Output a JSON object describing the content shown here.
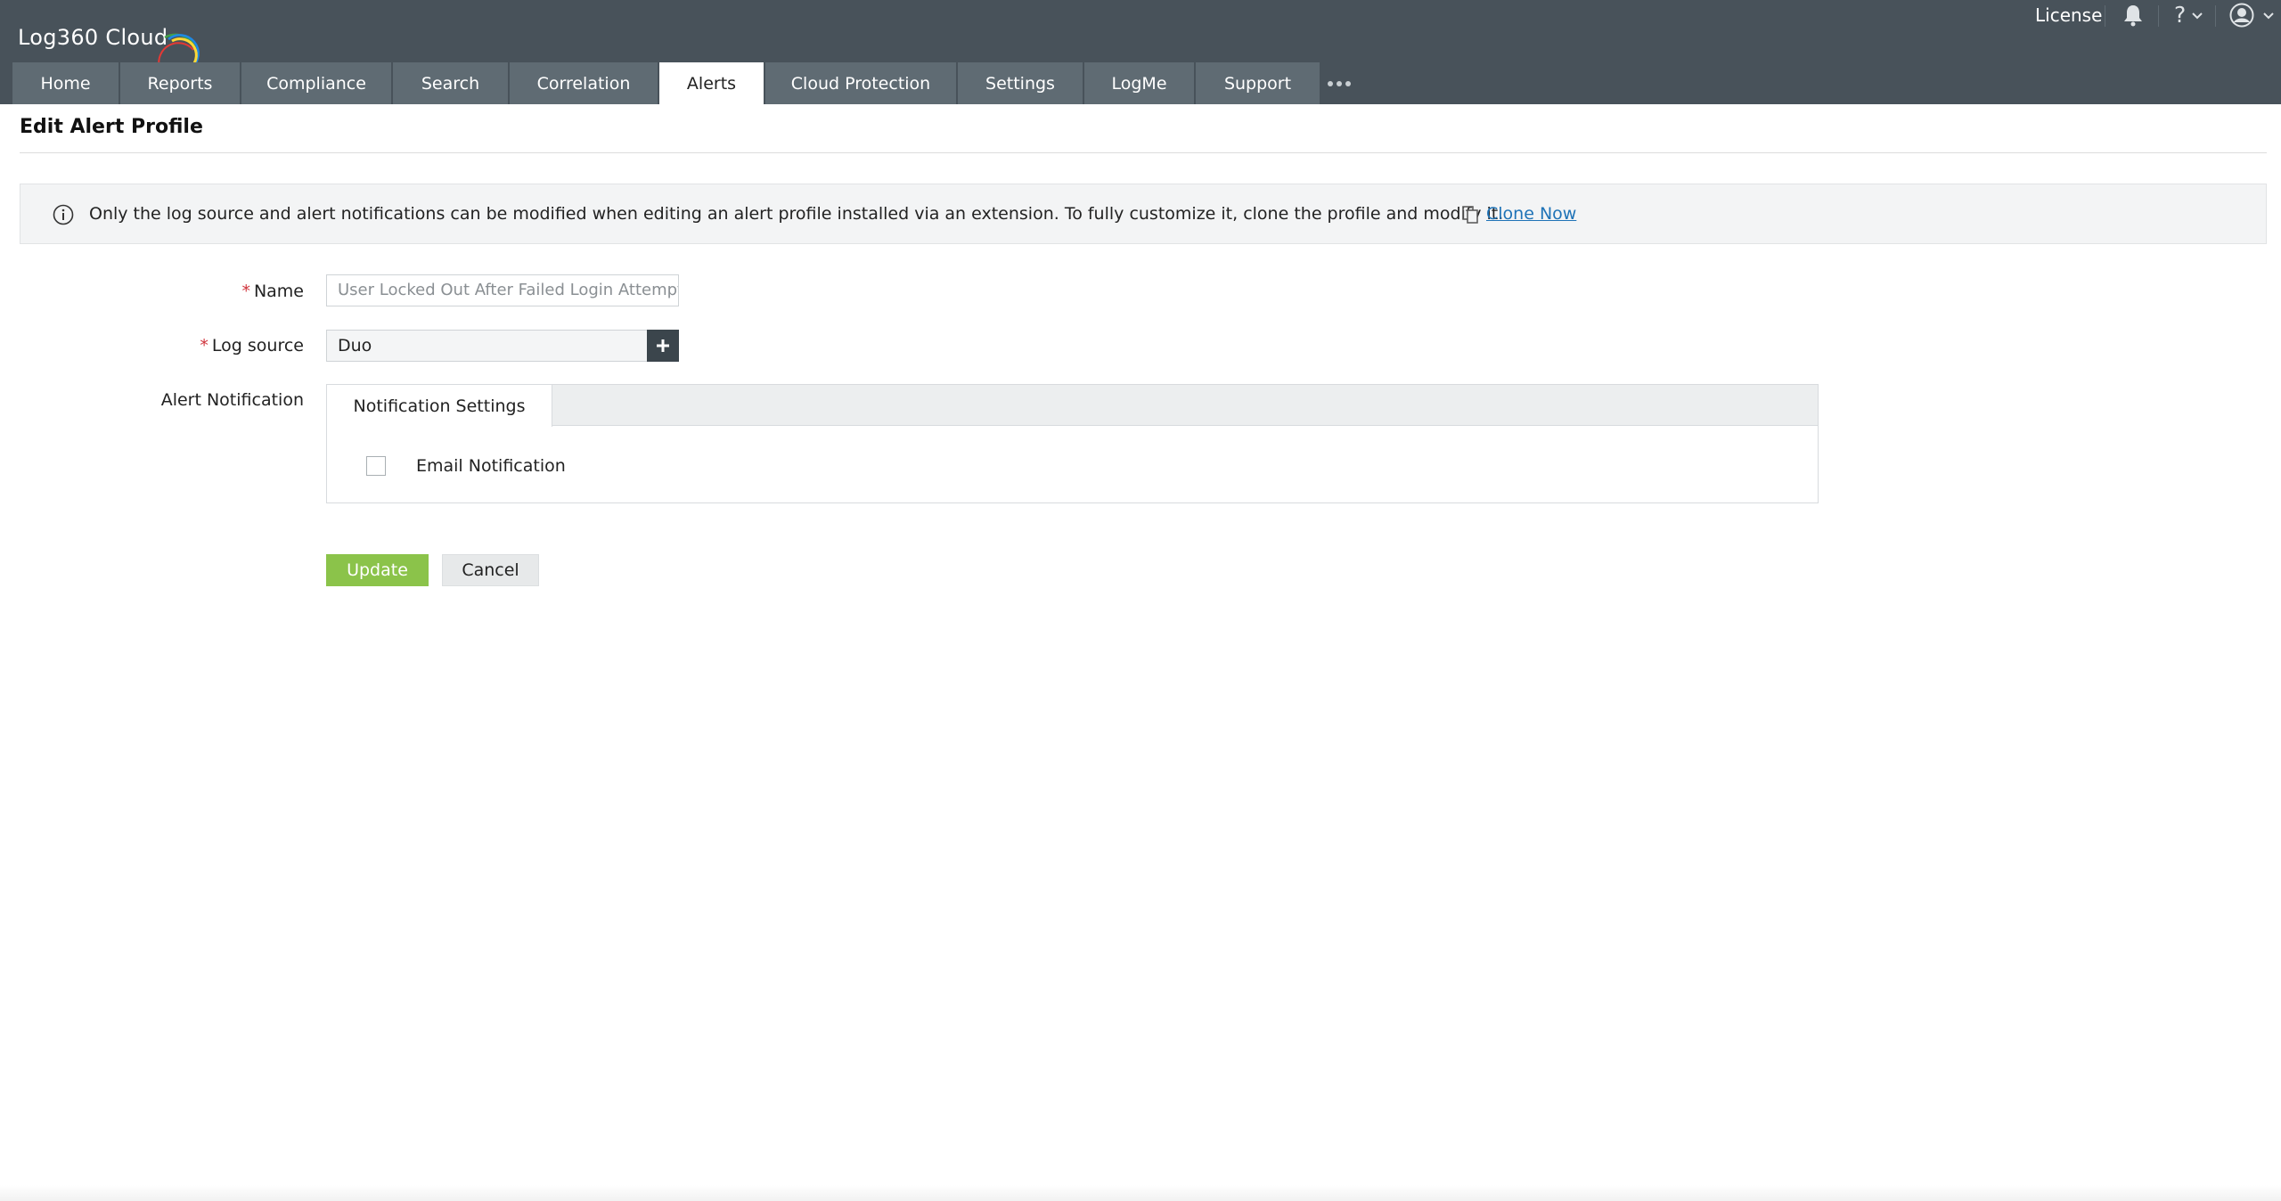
{
  "app": {
    "logo_text": "Log360 Cloud"
  },
  "header": {
    "license_label": "License",
    "help_label": "?"
  },
  "tabs": [
    {
      "label": "Home",
      "active": false
    },
    {
      "label": "Reports",
      "active": false
    },
    {
      "label": "Compliance",
      "active": false
    },
    {
      "label": "Search",
      "active": false
    },
    {
      "label": "Correlation",
      "active": false
    },
    {
      "label": "Alerts",
      "active": true
    },
    {
      "label": "Cloud Protection",
      "active": false
    },
    {
      "label": "Settings",
      "active": false
    },
    {
      "label": "LogMe",
      "active": false
    },
    {
      "label": "Support",
      "active": false
    }
  ],
  "page": {
    "title": "Edit Alert Profile"
  },
  "banner": {
    "message": "Only the log source and alert notifications can be modified when editing an alert profile installed via an extension. To fully customize it, clone the profile and modify it.",
    "clone_link": "Clone Now"
  },
  "form": {
    "required_mark": "*",
    "name_label": "Name",
    "name_value": "User Locked Out After Failed Login Attempts",
    "log_source_label": "Log source",
    "log_source_value": "Duo",
    "alert_notification_label": "Alert Notification",
    "notification_tab": "Notification Settings",
    "email_notification_label": "Email Notification",
    "email_notification_checked": false
  },
  "actions": {
    "update": "Update",
    "cancel": "Cancel"
  },
  "colors": {
    "header_bg": "#48525a",
    "tab_bg": "#5f6b73",
    "update_green": "#8bc34a",
    "link_blue": "#1f73b7",
    "required_red": "#d0343c"
  }
}
